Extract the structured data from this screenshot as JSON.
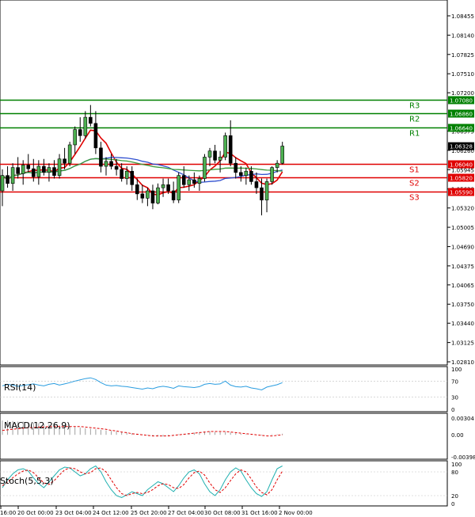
{
  "chart_data": [
    {
      "type": "candlestick",
      "panel": "price",
      "y_ticks": [
        "1.08455",
        "1.08140",
        "1.07825",
        "1.07510",
        "1.07200",
        "1.06575",
        "1.06260",
        "1.05945",
        "1.05630",
        "1.05320",
        "1.05005",
        "1.04690",
        "1.04375",
        "1.04065",
        "1.03750",
        "1.03440",
        "1.03125",
        "1.02810"
      ],
      "ylim": [
        1.0281,
        1.0869
      ],
      "current_price": "1.06328",
      "levels": [
        {
          "label": "R3",
          "value": 1.0708,
          "tag": "1.07080",
          "color": "#008000"
        },
        {
          "label": "R2",
          "value": 1.0686,
          "tag": "1.06860",
          "color": "#008000"
        },
        {
          "label": "R1",
          "value": 1.0664,
          "tag": "1.06640",
          "color": "#008000"
        },
        {
          "label": "S1",
          "value": 1.0604,
          "tag": "1.06040",
          "color": "#e00000"
        },
        {
          "label": "S2",
          "value": 1.0582,
          "tag": "1.05820",
          "color": "#e00000"
        },
        {
          "label": "S3",
          "value": 1.0559,
          "tag": "1.05590",
          "color": "#e00000"
        }
      ],
      "candles": [
        [
          1.056,
          1.0595,
          1.0535,
          1.0585
        ],
        [
          1.0585,
          1.06,
          1.0565,
          1.0572
        ],
        [
          1.0572,
          1.0605,
          1.056,
          1.0598
        ],
        [
          1.0598,
          1.0615,
          1.058,
          1.0588
        ],
        [
          1.0588,
          1.061,
          1.057,
          1.0602
        ],
        [
          1.0602,
          1.062,
          1.059,
          1.0596
        ],
        [
          1.0596,
          1.0612,
          1.0575,
          1.0583
        ],
        [
          1.0583,
          1.061,
          1.057,
          1.06
        ],
        [
          1.06,
          1.0612,
          1.0585,
          1.059
        ],
        [
          1.059,
          1.0605,
          1.0575,
          1.0598
        ],
        [
          1.0598,
          1.061,
          1.058,
          1.0585
        ],
        [
          1.0585,
          1.062,
          1.058,
          1.0612
        ],
        [
          1.0612,
          1.063,
          1.0595,
          1.0605
        ],
        [
          1.0605,
          1.064,
          1.06,
          1.0635
        ],
        [
          1.0635,
          1.0665,
          1.062,
          1.066
        ],
        [
          1.066,
          1.068,
          1.064,
          1.065
        ],
        [
          1.065,
          1.069,
          1.0645,
          1.068
        ],
        [
          1.068,
          1.07,
          1.0665,
          1.067
        ],
        [
          1.067,
          1.069,
          1.062,
          1.063
        ],
        [
          1.063,
          1.064,
          1.059,
          1.06
        ],
        [
          1.06,
          1.0615,
          1.0585,
          1.0608
        ],
        [
          1.0608,
          1.062,
          1.0595,
          1.06
        ],
        [
          1.06,
          1.0612,
          1.0585,
          1.0595
        ],
        [
          1.0595,
          1.0605,
          1.0575,
          1.058
        ],
        [
          1.058,
          1.06,
          1.057,
          1.0592
        ],
        [
          1.0592,
          1.06,
          1.056,
          1.057
        ],
        [
          1.057,
          1.058,
          1.0545,
          1.0555
        ],
        [
          1.0555,
          1.057,
          1.054,
          1.0548
        ],
        [
          1.0548,
          1.0565,
          1.0535,
          1.056
        ],
        [
          1.056,
          1.057,
          1.053,
          1.054
        ],
        [
          1.054,
          1.0572,
          1.0538,
          1.0565
        ],
        [
          1.0565,
          1.058,
          1.055,
          1.057
        ],
        [
          1.057,
          1.058,
          1.0555,
          1.056
        ],
        [
          1.056,
          1.0575,
          1.054,
          1.0545
        ],
        [
          1.0545,
          1.059,
          1.054,
          1.0585
        ],
        [
          1.0585,
          1.06,
          1.0565,
          1.057
        ],
        [
          1.057,
          1.0585,
          1.056,
          1.0578
        ],
        [
          1.0578,
          1.059,
          1.0565,
          1.0572
        ],
        [
          1.0572,
          1.0585,
          1.056,
          1.058
        ],
        [
          1.058,
          1.062,
          1.0575,
          1.0615
        ],
        [
          1.0615,
          1.063,
          1.06,
          1.0625
        ],
        [
          1.0625,
          1.0635,
          1.0605,
          1.061
        ],
        [
          1.061,
          1.0625,
          1.059,
          1.0615
        ],
        [
          1.0615,
          1.0655,
          1.061,
          1.065
        ],
        [
          1.065,
          1.0675,
          1.06,
          1.0605
        ],
        [
          1.0605,
          1.0615,
          1.058,
          1.059
        ],
        [
          1.059,
          1.06,
          1.0575,
          1.0585
        ],
        [
          1.0585,
          1.0598,
          1.057,
          1.0592
        ],
        [
          1.0592,
          1.06,
          1.057,
          1.0575
        ],
        [
          1.0575,
          1.059,
          1.0555,
          1.0565
        ],
        [
          1.0565,
          1.058,
          1.052,
          1.0545
        ],
        [
          1.0545,
          1.058,
          1.0525,
          1.0575
        ],
        [
          1.0575,
          1.06,
          1.057,
          1.0598
        ],
        [
          1.0598,
          1.061,
          1.059,
          1.0605
        ],
        [
          1.0605,
          1.064,
          1.0603,
          1.0633
        ]
      ]
    },
    {
      "type": "line",
      "panel": "RSI",
      "title": "RSI(14)",
      "ylim": [
        0,
        100
      ],
      "y_ticks": [
        "100",
        "70",
        "30",
        "0"
      ],
      "values": [
        58,
        62,
        60,
        57,
        59,
        61,
        63,
        60,
        58,
        62,
        64,
        60,
        63,
        66,
        70,
        73,
        76,
        78,
        74,
        66,
        60,
        58,
        59,
        57,
        56,
        54,
        52,
        50,
        53,
        51,
        55,
        57,
        55,
        52,
        58,
        56,
        55,
        54,
        56,
        62,
        64,
        62,
        63,
        70,
        60,
        56,
        55,
        57,
        53,
        51,
        48,
        55,
        58,
        61,
        66
      ]
    },
    {
      "type": "bar+line",
      "panel": "MACD",
      "title": "MACD(12,26,9)",
      "ylim": [
        -0.003983,
        0.00304
      ],
      "y_ticks": [
        "0.00304",
        "0.00",
        "-0.003983"
      ],
      "histogram": [
        0.0026,
        0.0026,
        0.0025,
        0.0024,
        0.0024,
        0.0023,
        0.0022,
        0.0021,
        0.002,
        0.0019,
        0.0018,
        0.0017,
        0.0016,
        0.0015,
        0.0014,
        0.0013,
        0.0012,
        0.0011,
        0.001,
        0.0009,
        0.0008,
        0.0007,
        0.0006,
        0.0005,
        0.0004,
        0.0003,
        0.0002,
        0.0001,
        -0.0001,
        -0.0002,
        -0.0003,
        -0.0003,
        -0.0002,
        -0.0001,
        0.0001,
        0.0002,
        0.0003,
        0.0004,
        0.0005,
        0.0006,
        0.0006,
        0.0005,
        0.0005,
        0.0005,
        0.0004,
        0.0003,
        0.0002,
        0.0001,
        0.0001,
        0.0,
        -0.0001,
        0.0,
        0.0001,
        0.0001,
        0.0002
      ],
      "signal": [
        0.0008,
        0.0009,
        0.001,
        0.0011,
        0.0012,
        0.0013,
        0.0013,
        0.0014,
        0.0014,
        0.0015,
        0.0015,
        0.0015,
        0.0015,
        0.0015,
        0.0015,
        0.0015,
        0.0014,
        0.0013,
        0.0012,
        0.0011,
        0.001,
        0.0008,
        0.0007,
        0.0005,
        0.0004,
        0.0002,
        0.0001,
        0.0,
        -0.0001,
        -0.0002,
        -0.0002,
        -0.0002,
        -0.0002,
        -0.0001,
        0.0,
        0.0001,
        0.0002,
        0.0003,
        0.0004,
        0.0005,
        0.0006,
        0.0006,
        0.0006,
        0.0006,
        0.0005,
        0.0004,
        0.0003,
        0.0002,
        0.0001,
        0.0,
        -0.0001,
        -0.0002,
        -0.0002,
        -0.0001,
        0.0
      ]
    },
    {
      "type": "line",
      "panel": "Stochastic",
      "title": "Stoch(5,5,3)",
      "ylim": [
        0,
        100
      ],
      "y_ticks": [
        "100",
        "80",
        "20",
        "0"
      ],
      "k": [
        40,
        60,
        75,
        85,
        88,
        82,
        65,
        50,
        40,
        55,
        70,
        85,
        92,
        90,
        80,
        70,
        75,
        88,
        95,
        80,
        55,
        35,
        20,
        15,
        22,
        30,
        25,
        20,
        35,
        45,
        55,
        50,
        40,
        30,
        45,
        65,
        80,
        85,
        75,
        50,
        30,
        20,
        35,
        60,
        80,
        90,
        82,
        60,
        40,
        25,
        18,
        30,
        60,
        88,
        95
      ],
      "d": [
        45,
        55,
        65,
        75,
        82,
        85,
        78,
        65,
        52,
        48,
        58,
        72,
        85,
        90,
        88,
        80,
        75,
        78,
        88,
        90,
        80,
        60,
        40,
        25,
        20,
        25,
        28,
        25,
        28,
        35,
        45,
        50,
        48,
        40,
        38,
        48,
        65,
        78,
        82,
        72,
        52,
        35,
        28,
        40,
        58,
        75,
        85,
        80,
        62,
        42,
        28,
        22,
        35,
        60,
        82
      ]
    }
  ],
  "x_labels": [
    "16:00",
    "20 Oct 00:00",
    "23 Oct 04:00",
    "24 Oct 12:00",
    "25 Oct 20:00",
    "27 Oct 04:00",
    "30 Oct 08:00",
    "31 Oct 16:00",
    "2 Nov 00:00"
  ]
}
